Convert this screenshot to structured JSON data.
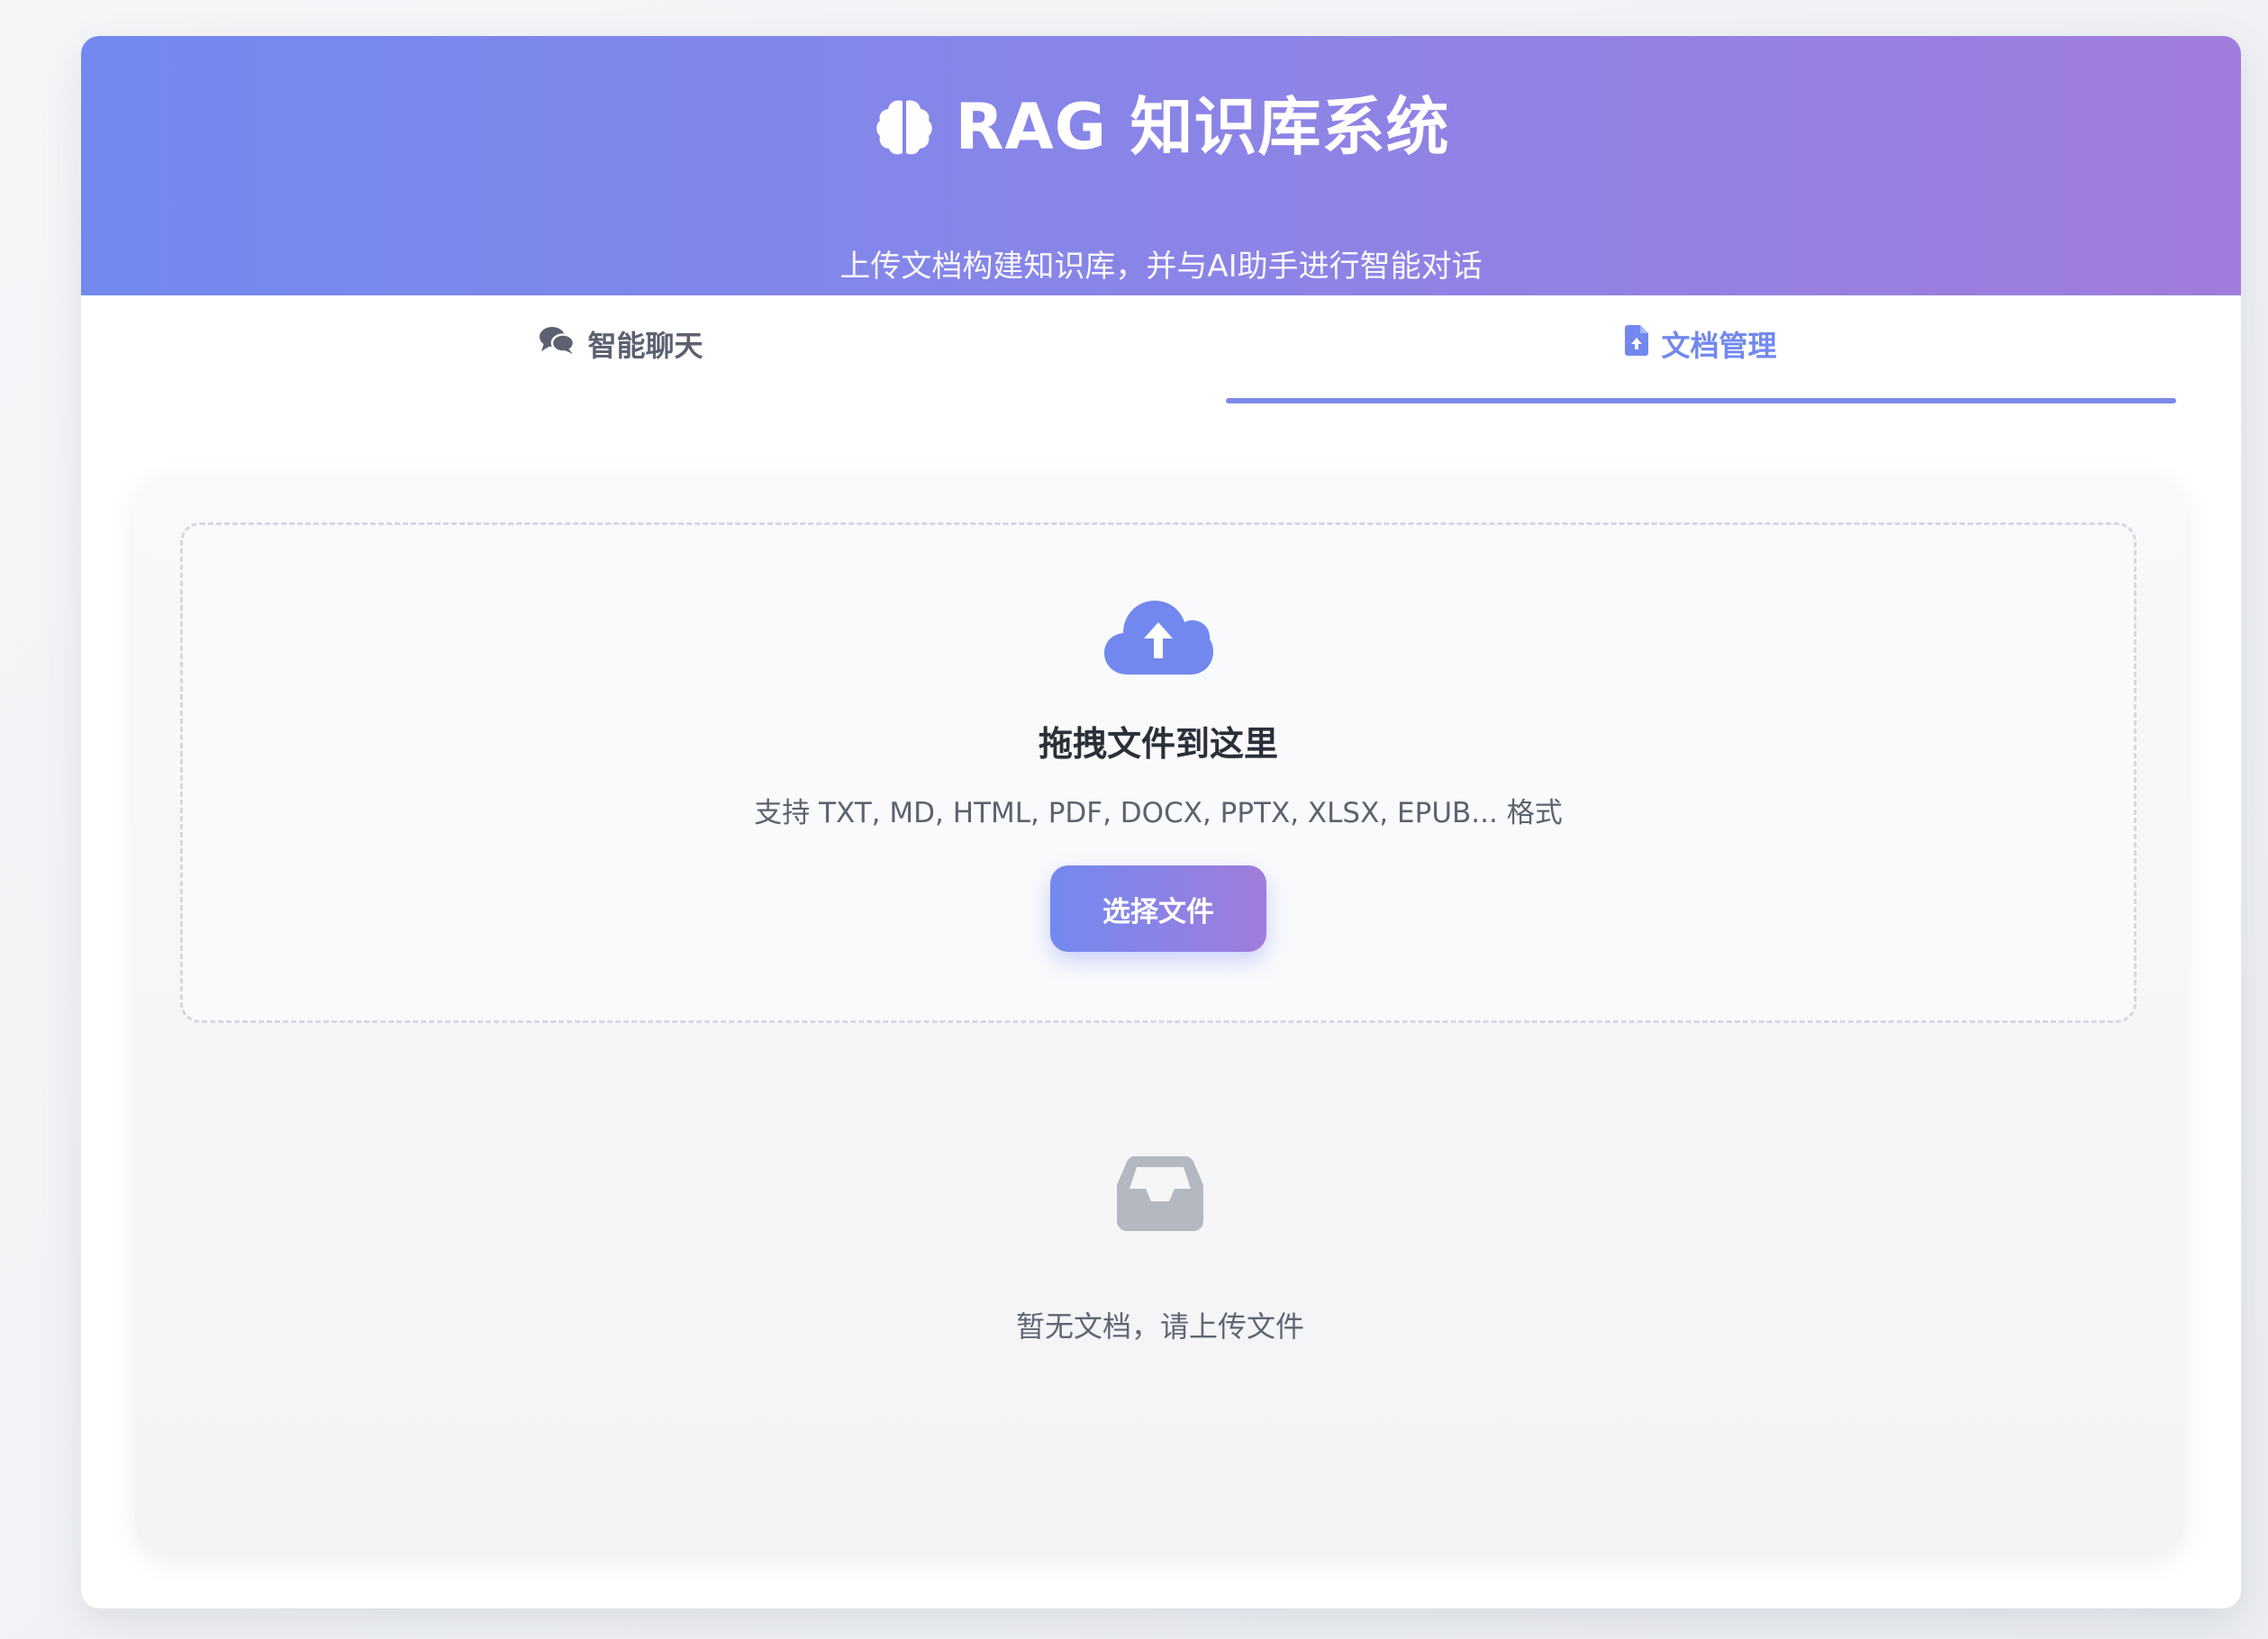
{
  "header": {
    "title": "RAG 知识库系统",
    "subtitle": "上传文档构建知识库，并与AI助手进行智能对话",
    "brain_icon": "brain-icon"
  },
  "tabs": [
    {
      "label": "智能聊天",
      "icon": "comments-icon",
      "active": false
    },
    {
      "label": "文档管理",
      "icon": "file-upload-icon",
      "active": true
    }
  ],
  "upload": {
    "icon": "cloud-upload-icon",
    "title": "拖拽文件到这里",
    "formats": "支持 TXT, MD, HTML, PDF, DOCX, PPTX, XLSX, EPUB... 格式",
    "button_label": "选择文件"
  },
  "documents": {
    "empty_icon": "inbox-icon",
    "empty_text": "暂无文档，请上传文件"
  },
  "colors": {
    "accent": "#7288ee",
    "gradient_start": "#7389f0",
    "gradient_end": "#a07cdc"
  }
}
